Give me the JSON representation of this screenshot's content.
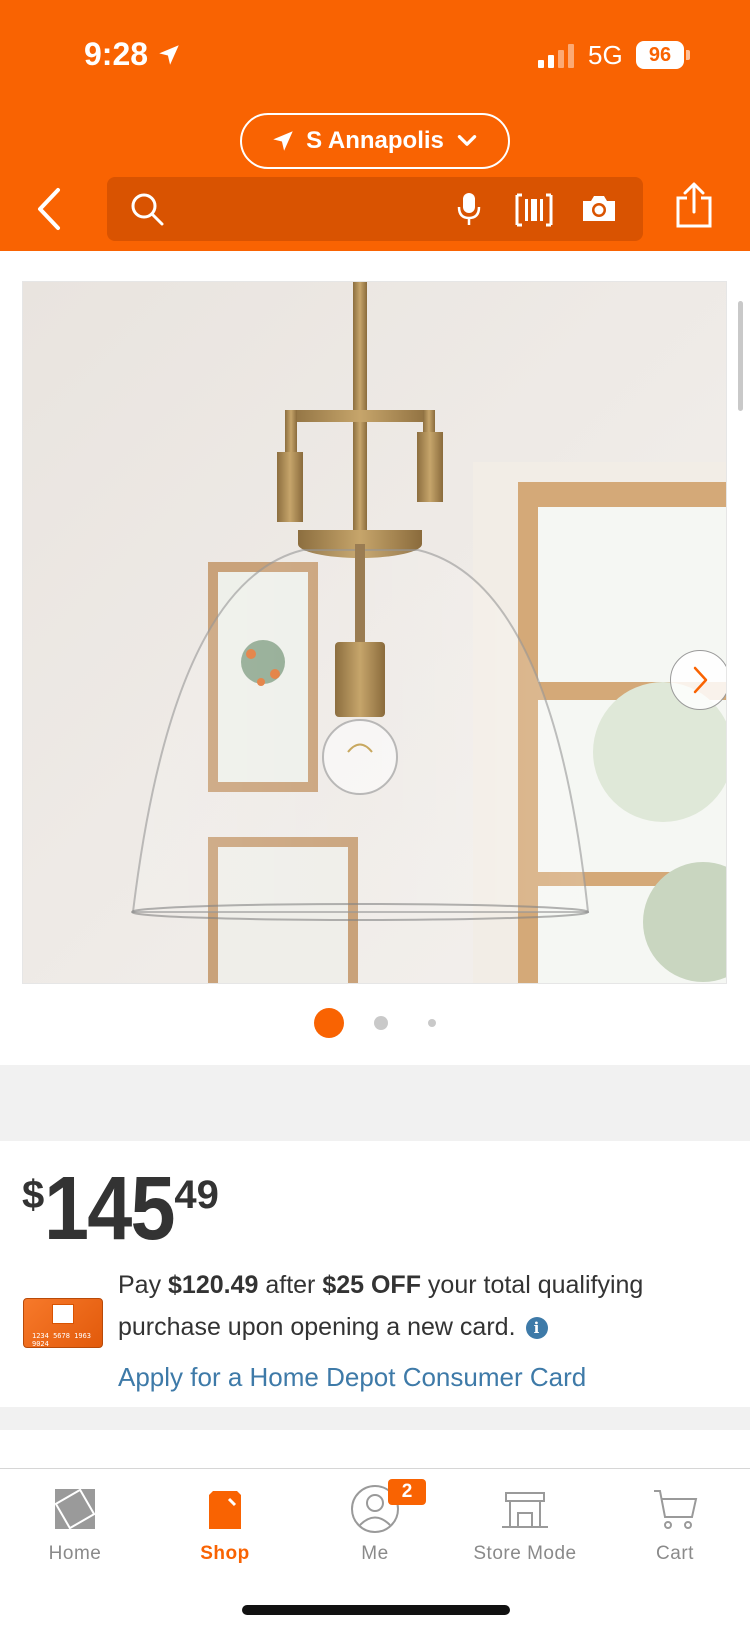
{
  "status_bar": {
    "time": "9:28",
    "network": "5G",
    "battery": "96"
  },
  "header": {
    "location": "S Annapolis",
    "search_placeholder": "",
    "accent_color": "#f96302"
  },
  "gallery": {
    "image_count": 3,
    "active_index": 0
  },
  "price": {
    "currency": "$",
    "dollars": "145",
    "cents": "49"
  },
  "promo": {
    "text_pay": "Pay ",
    "discounted_price": "$120.49",
    "text_after": " after ",
    "discount": "$25 OFF",
    "text_rest": " your total qualifying purchase upon opening a new card.",
    "info_glyph": "i",
    "card_number": "1234 5678 1963 9024",
    "apply_link": "Apply for a Home Depot Consumer Card"
  },
  "tabs": [
    {
      "label": "Home",
      "icon": "home-depot-logo-icon",
      "active": false
    },
    {
      "label": "Shop",
      "icon": "shop-bag-icon",
      "active": true
    },
    {
      "label": "Me",
      "icon": "user-icon",
      "active": false,
      "badge": "2"
    },
    {
      "label": "Store Mode",
      "icon": "store-icon",
      "active": false
    },
    {
      "label": "Cart",
      "icon": "cart-icon",
      "active": false
    }
  ]
}
